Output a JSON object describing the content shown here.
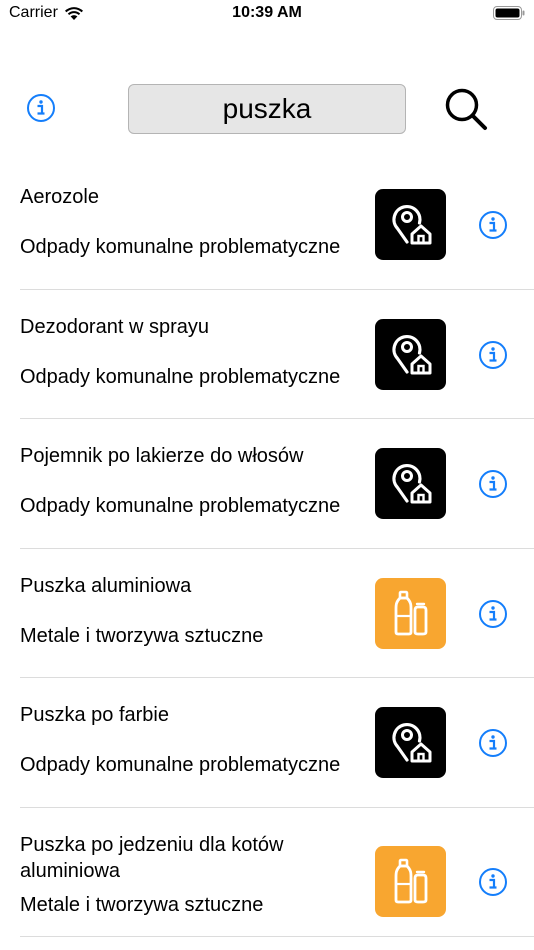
{
  "status_bar": {
    "carrier": "Carrier",
    "time": "10:39 AM"
  },
  "header": {
    "search_value": "puszka",
    "info_icon": "info-circle-icon",
    "search_icon": "magnifier-icon"
  },
  "colors": {
    "accent_blue": "#147efb",
    "problematic_tile": "#000000",
    "metals_plastics_tile": "#f8a630",
    "search_field_bg": "#e6e6e6",
    "divider": "#dcdcdc"
  },
  "results": [
    {
      "name": "Aerozole",
      "category": "Odpady komunalne problematyczne",
      "icon": "location-home-icon"
    },
    {
      "name": "Dezodorant w sprayu",
      "category": "Odpady komunalne problematyczne",
      "icon": "location-home-icon"
    },
    {
      "name": "Pojemnik po lakierze do włosów",
      "category": "Odpady komunalne problematyczne",
      "icon": "location-home-icon"
    },
    {
      "name": "Puszka aluminiowa",
      "category": "Metale i tworzywa sztuczne",
      "icon": "bottle-can-icon"
    },
    {
      "name": "Puszka po farbie",
      "category": "Odpady komunalne problematyczne",
      "icon": "location-home-icon"
    },
    {
      "name": "Puszka po jedzeniu dla kotów aluminiowa",
      "category": "Metale i tworzywa sztuczne",
      "icon": "bottle-can-icon"
    }
  ]
}
